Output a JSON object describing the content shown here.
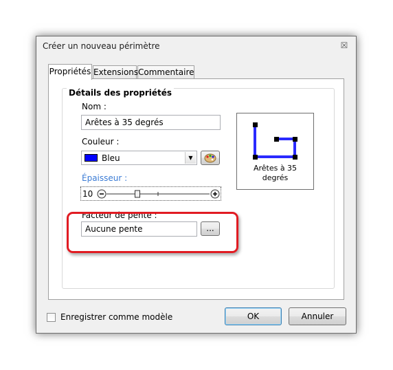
{
  "window": {
    "title": "Créer un nouveau périmètre",
    "close_symbol": "☒"
  },
  "tabs": [
    {
      "label": "Propriétés",
      "active": true
    },
    {
      "label": "Extensions",
      "active": false
    },
    {
      "label": "Commentaire",
      "active": false
    }
  ],
  "group": {
    "title": "Détails des propriétés"
  },
  "name": {
    "label": "Nom :",
    "value": "Arêtes à 35 degrés"
  },
  "color": {
    "label": "Couleur :",
    "value": "Bleu",
    "swatch": "#0000ff",
    "icon": "palette-icon"
  },
  "thickness": {
    "label": "Épaisseur :",
    "label_color": "#3a7bd5",
    "value": "10",
    "level": 0.3
  },
  "slope": {
    "label": "Facteur de pente :",
    "value": "Aucune pente",
    "browse_label": "..."
  },
  "preview": {
    "caption_line1": "Arêtes à 35",
    "caption_line2": "degrés",
    "stroke_color": "#2a2aff"
  },
  "footer": {
    "save_template_label": "Enregistrer comme modèle",
    "save_template_checked": false,
    "ok_label": "OK",
    "cancel_label": "Annuler"
  },
  "highlight_color": "#e11b22"
}
